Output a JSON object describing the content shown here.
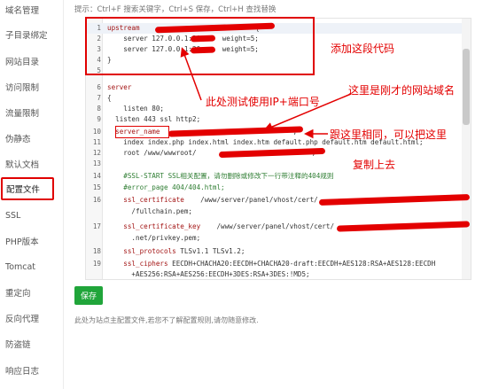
{
  "sidebar": {
    "items": [
      {
        "label": "域名管理"
      },
      {
        "label": "子目录绑定"
      },
      {
        "label": "网站目录"
      },
      {
        "label": "访问限制"
      },
      {
        "label": "流量限制"
      },
      {
        "label": "伪静态"
      },
      {
        "label": "默认文档"
      },
      {
        "label": "配置文件",
        "active": true
      },
      {
        "label": "SSL"
      },
      {
        "label": "PHP版本"
      },
      {
        "label": "Tomcat"
      },
      {
        "label": "重定向"
      },
      {
        "label": "反向代理"
      },
      {
        "label": "防盗链"
      },
      {
        "label": "响应日志"
      }
    ]
  },
  "hint": "提示：Ctrl+F 搜索关键字，Ctrl+S 保存，Ctrl+H 查找替换",
  "editor": {
    "lines": [
      {
        "n": "1",
        "kw": "upstream",
        "text": "",
        "tail": " {"
      },
      {
        "n": "2",
        "text": "    server 127.0.0.1:20",
        "tail": " weight=5;"
      },
      {
        "n": "3",
        "text": "    server 127.0.0.1:20",
        "tail": " weight=5;"
      },
      {
        "n": "4",
        "text": "}"
      },
      {
        "n": "5",
        "text": ""
      },
      {
        "n": "6",
        "kw": "server",
        "text": ""
      },
      {
        "n": "7",
        "text": "{"
      },
      {
        "n": "8",
        "text": "    listen 80;"
      },
      {
        "n": "9",
        "text": "  listen 443 ssl http2;"
      },
      {
        "n": "10",
        "prop": "  server_name",
        "text": "",
        "tail": ";"
      },
      {
        "n": "11",
        "text": "    index index.php index.html index.htm default.php default.htm default.html;"
      },
      {
        "n": "12",
        "text": "    root /www/wwwroot/",
        "tail": ";"
      },
      {
        "n": "13",
        "text": ""
      },
      {
        "n": "14",
        "cm": "    #SSL-START SSL相关配置，请勿删除或修改下一行带注释的404规则"
      },
      {
        "n": "15",
        "cm": "    #error_page 404/404.html;"
      },
      {
        "n": "16",
        "prop": "    ssl_certificate",
        "text": "    /www/server/panel/vhost/cert/"
      },
      {
        "n": "",
        "text": "      /fullchain.pem;"
      },
      {
        "n": "17",
        "prop": "    ssl_certificate_key",
        "text": "    /www/server/panel/vhost/cert/"
      },
      {
        "n": "",
        "text": "      .net/privkey.pem;"
      },
      {
        "n": "18",
        "prop": "    ssl_protocols",
        "text": " TLSv1.1 TLSv1.2;"
      },
      {
        "n": "19",
        "prop": "    ssl_ciphers",
        "text": " EECDH+CHACHA20:EECDH+CHACHA20-draft:EECDH+AES128:RSA+AES128:EECDH"
      },
      {
        "n": "",
        "text": "      +AES256:RSA+AES256:EECDH+3DES:RSA+3DES:!MD5;"
      }
    ]
  },
  "annotations": {
    "add_code": "添加这段代码",
    "site_name": "这里是刚才的网站域名",
    "test_ip": "此处测试使用IP+端口号",
    "same_here": "跟这里相同，可以把这里",
    "copy_over": "复制上去"
  },
  "save_label": "保存",
  "note": "此处为站点主配置文件,若您不了解配置规则,请勿随意修改."
}
